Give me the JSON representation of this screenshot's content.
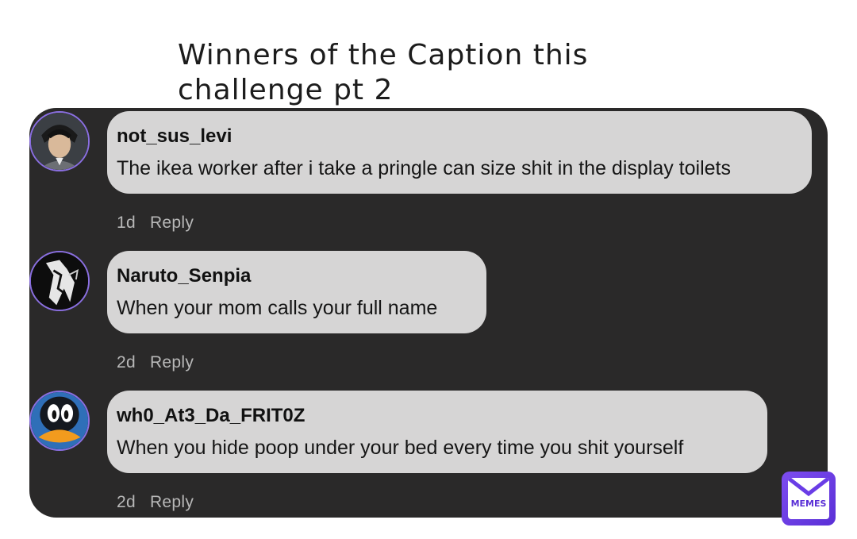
{
  "title": "Winners of the Caption this challenge pt 2",
  "comments": [
    {
      "username": "not_sus_levi",
      "text": "The ikea worker after i take a pringle can size shit in the display toilets",
      "time": "1d",
      "reply": "Reply"
    },
    {
      "username": "Naruto_Senpia",
      "text": "When your mom calls your full name",
      "time": "2d",
      "reply": "Reply"
    },
    {
      "username": "wh0_At3_Da_FRIT0Z",
      "text": "When you hide poop under your bed every time you shit yourself",
      "time": "2d",
      "reply": "Reply"
    }
  ],
  "watermark": "MEMES",
  "colors": {
    "panel": "#2a2929",
    "bubble": "#d6d5d5",
    "avatar_ring": "#8a6fe0",
    "logo": "#6a3de6"
  }
}
